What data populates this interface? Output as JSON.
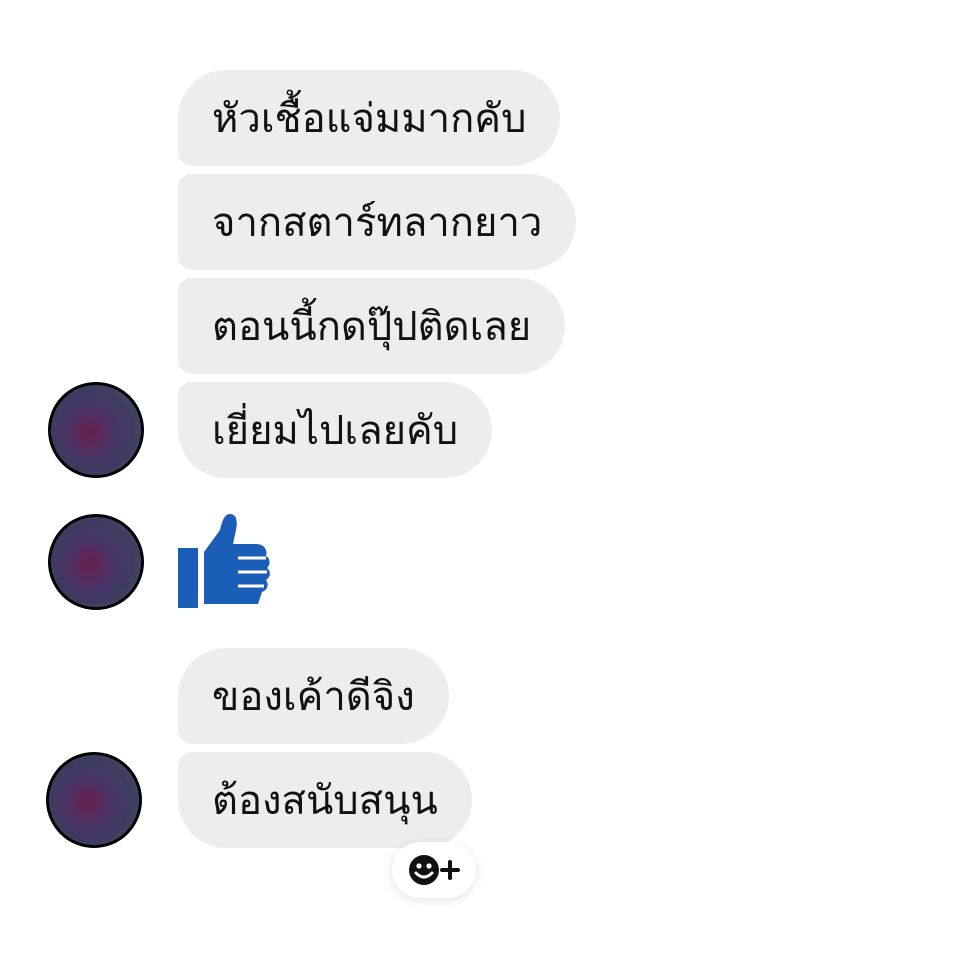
{
  "messages": [
    {
      "text": "หัวเชื้อแจ่มมากคับ"
    },
    {
      "text": "จากสตาร์ทลากยาว"
    },
    {
      "text": "ตอนนี้กดปุ๊ปติดเลย"
    },
    {
      "text": "เยี่ยมไปเลยคับ"
    },
    {
      "text": "ของเค้าดีจิง"
    },
    {
      "text": "ต้องสนับสนุน"
    }
  ],
  "icons": {
    "like": "thumbs-up-icon",
    "reaction": "add-reaction-icon"
  },
  "colors": {
    "bubble": "#ededed",
    "like_blue": "#1b5eb8",
    "background": "#ffffff"
  }
}
